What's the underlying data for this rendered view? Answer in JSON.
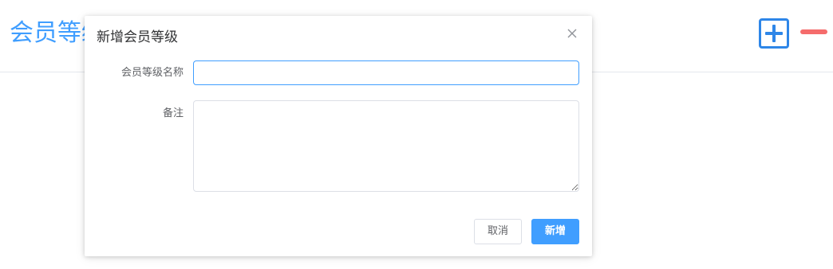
{
  "page": {
    "title": "会员等级"
  },
  "dialog": {
    "title": "新增会员等级",
    "fields": {
      "name_label": "会员等级名称",
      "name_value": "",
      "remark_label": "备注",
      "remark_value": ""
    },
    "buttons": {
      "cancel_label": "取消",
      "confirm_label": "新增"
    }
  },
  "icons": {
    "add": "plus-square-icon",
    "remove": "minus-icon",
    "close": "close-icon"
  },
  "colors": {
    "primary": "#409eff",
    "add_icon": "#2e86e8",
    "danger": "#f56c6c"
  }
}
